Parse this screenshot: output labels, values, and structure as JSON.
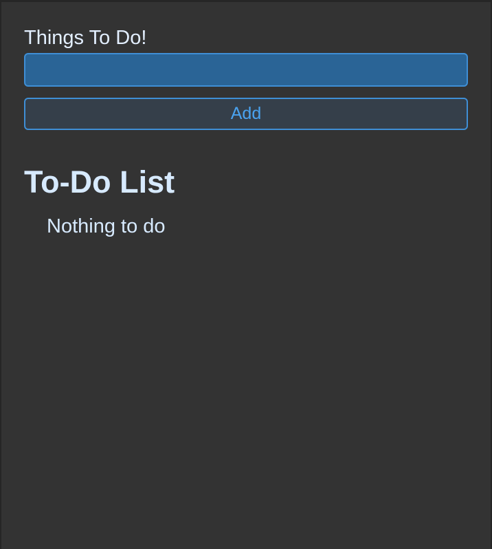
{
  "form": {
    "label": "Things To Do!",
    "input_value": "",
    "input_placeholder": "",
    "add_button_label": "Add"
  },
  "todo_list": {
    "heading": "To-Do List",
    "empty_message": "Nothing to do",
    "items": []
  },
  "colors": {
    "background": "#333333",
    "input_fill": "#2a6496",
    "accent_border": "#3f8fd6",
    "button_text": "#4aa3f0",
    "text": "#d7eaff"
  }
}
